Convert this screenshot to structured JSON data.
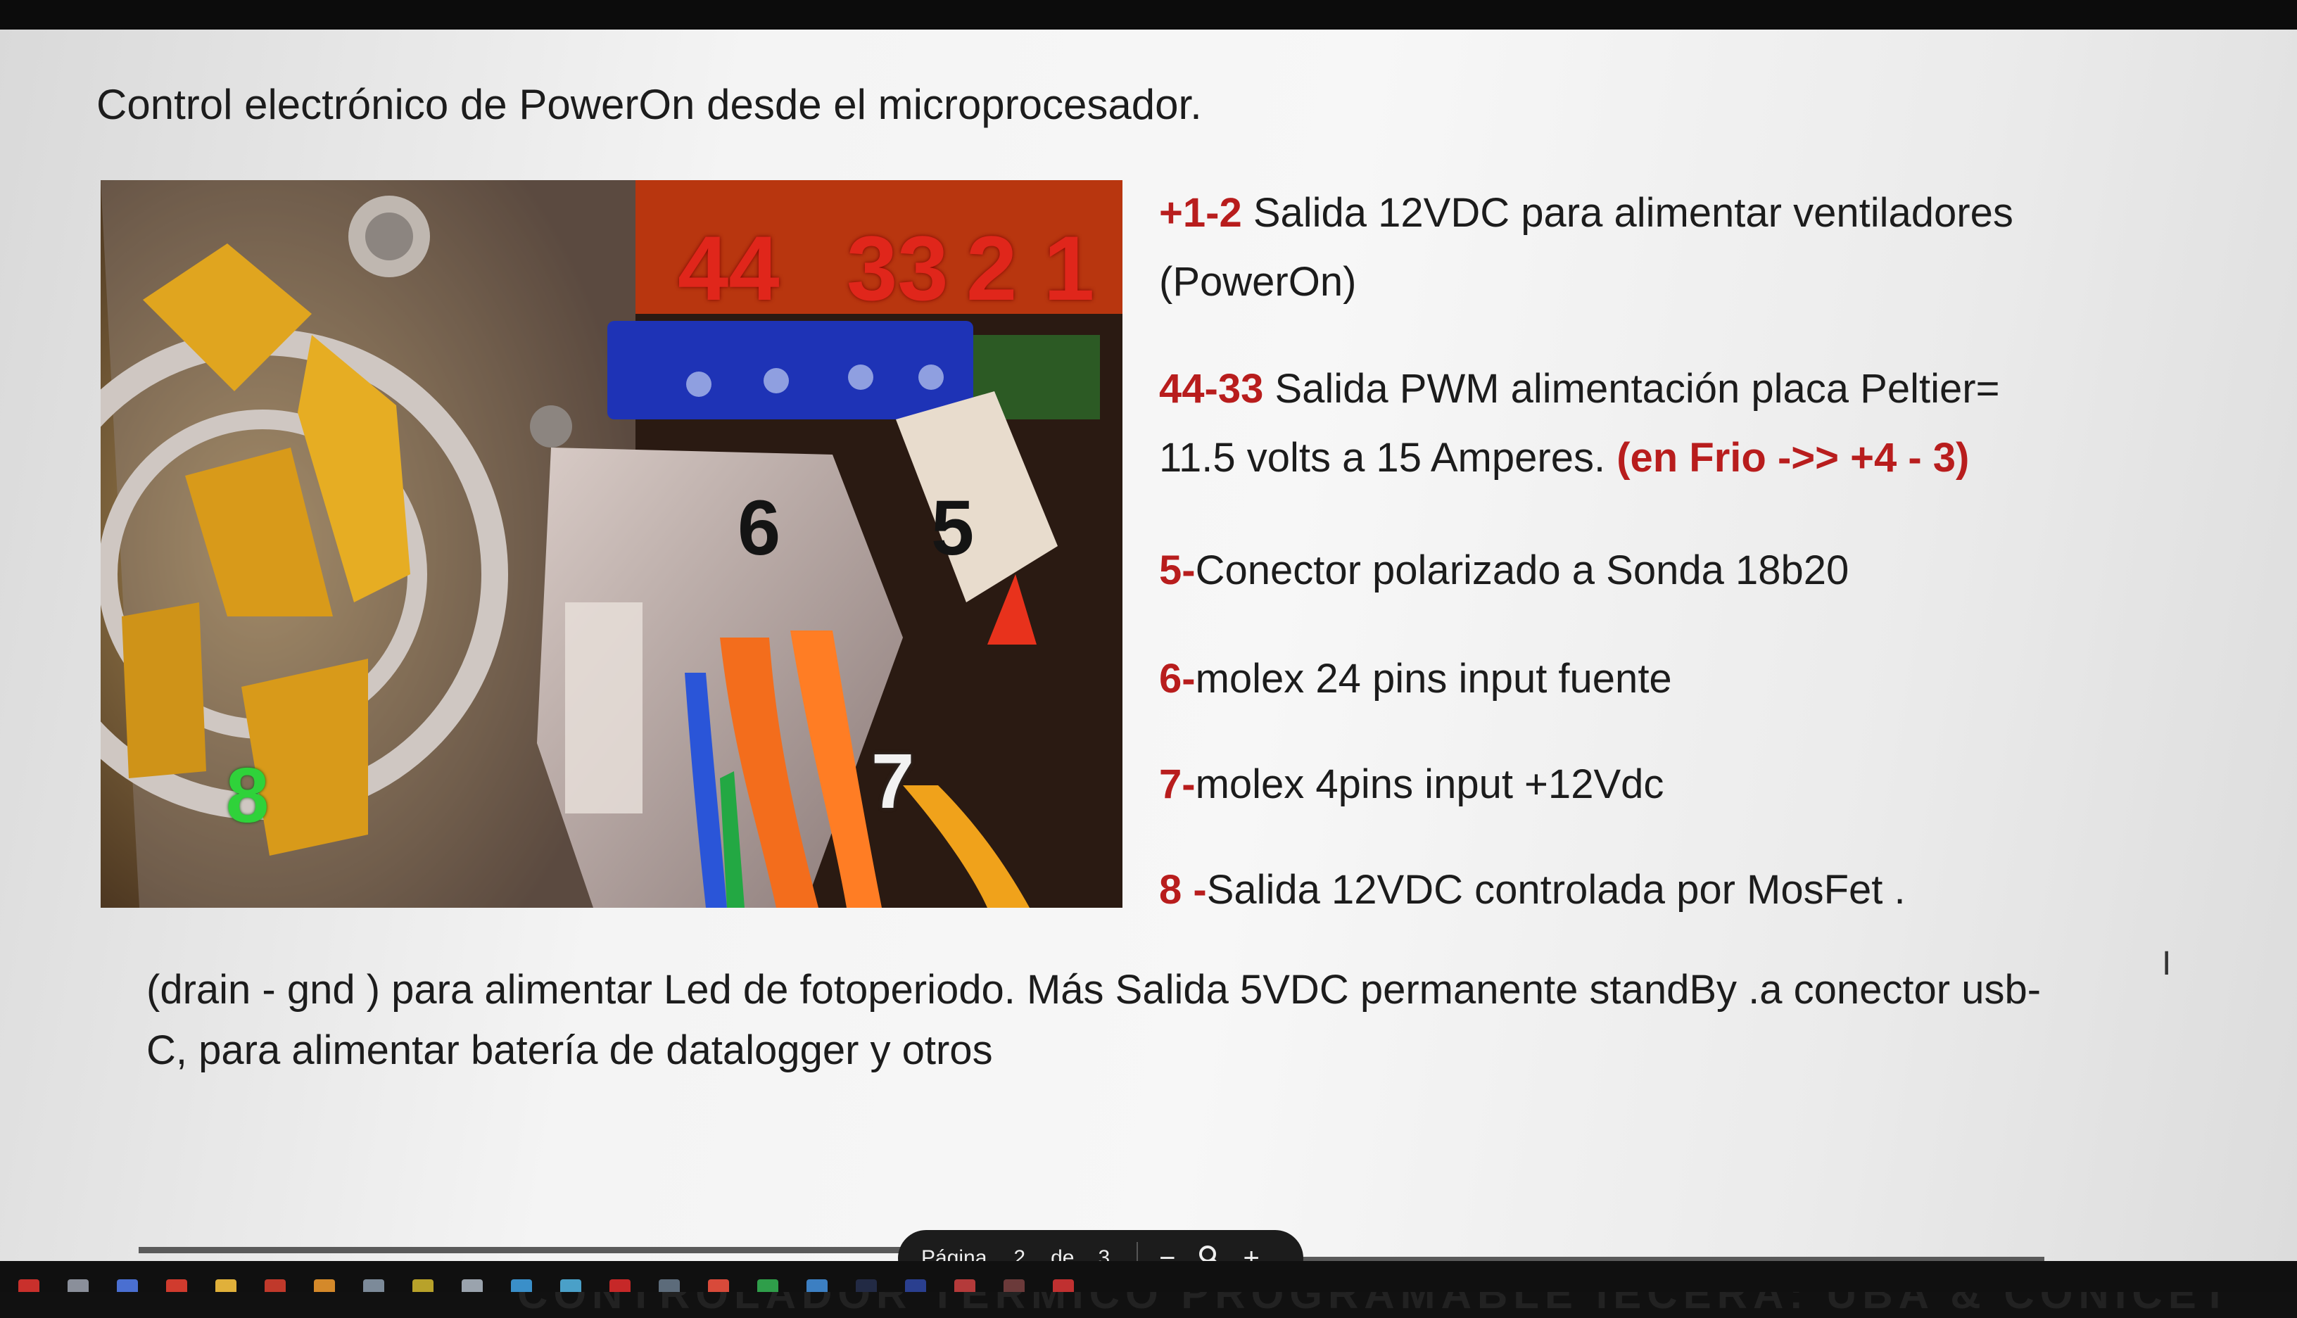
{
  "heading": "Control electrónico de PowerOn desde el microprocesador.",
  "photo": {
    "labels": [
      "44",
      "33",
      "2",
      "1",
      "6",
      "5",
      "7",
      "8"
    ]
  },
  "legend": [
    {
      "code": "+1-2",
      "text": " Salida 12VDC para alimentar ventiladores",
      "text2": "(PowerOn)"
    },
    {
      "code": "44-33",
      "text": " Salida PWM alimentación placa Peltier=",
      "text2": "11.5 volts a 15 Amperes. ",
      "note": "(en Frio ->>   +4  - 3)"
    },
    {
      "code": "5-",
      "text": "Conector polarizado a Sonda 18b20"
    },
    {
      "code": "6-",
      "text": "molex 24 pins input fuente"
    },
    {
      "code": "7-",
      "text": "molex 4pins input +12Vdc"
    },
    {
      "code": "8 -",
      "text": "Salida 12VDC controlada por MosFet ."
    }
  ],
  "footer_paragraph": "(drain - gnd ) para alimentar Led de fotoperiodo.  Más Salida 5VDC permanente standBy .a conector usb-C, para alimentar batería de datalogger y otros",
  "page_nav": {
    "label": "Página",
    "current": "2",
    "of": "de",
    "total": "3",
    "zoom_out": "−",
    "zoom_in": "+"
  },
  "next_page_title": "CONTROLADOR TERMICO PROGRAMABLE  IECERA: UBA  &  CONICET",
  "colors": {
    "label_red": "#b81d1d",
    "photo_label_red": "#e0261b",
    "photo_label_green": "#2fd23a",
    "nav_bg": "#1c1c1c"
  },
  "taskbar_icons": [
    "app-icon",
    "app-icon",
    "app-icon",
    "app-icon",
    "app-icon",
    "app-icon",
    "app-icon",
    "app-icon",
    "app-icon",
    "app-icon",
    "app-icon",
    "app-icon",
    "app-icon",
    "app-icon",
    "app-icon",
    "app-icon",
    "app-icon",
    "app-icon",
    "app-icon",
    "app-icon",
    "app-icon",
    "app-icon"
  ]
}
